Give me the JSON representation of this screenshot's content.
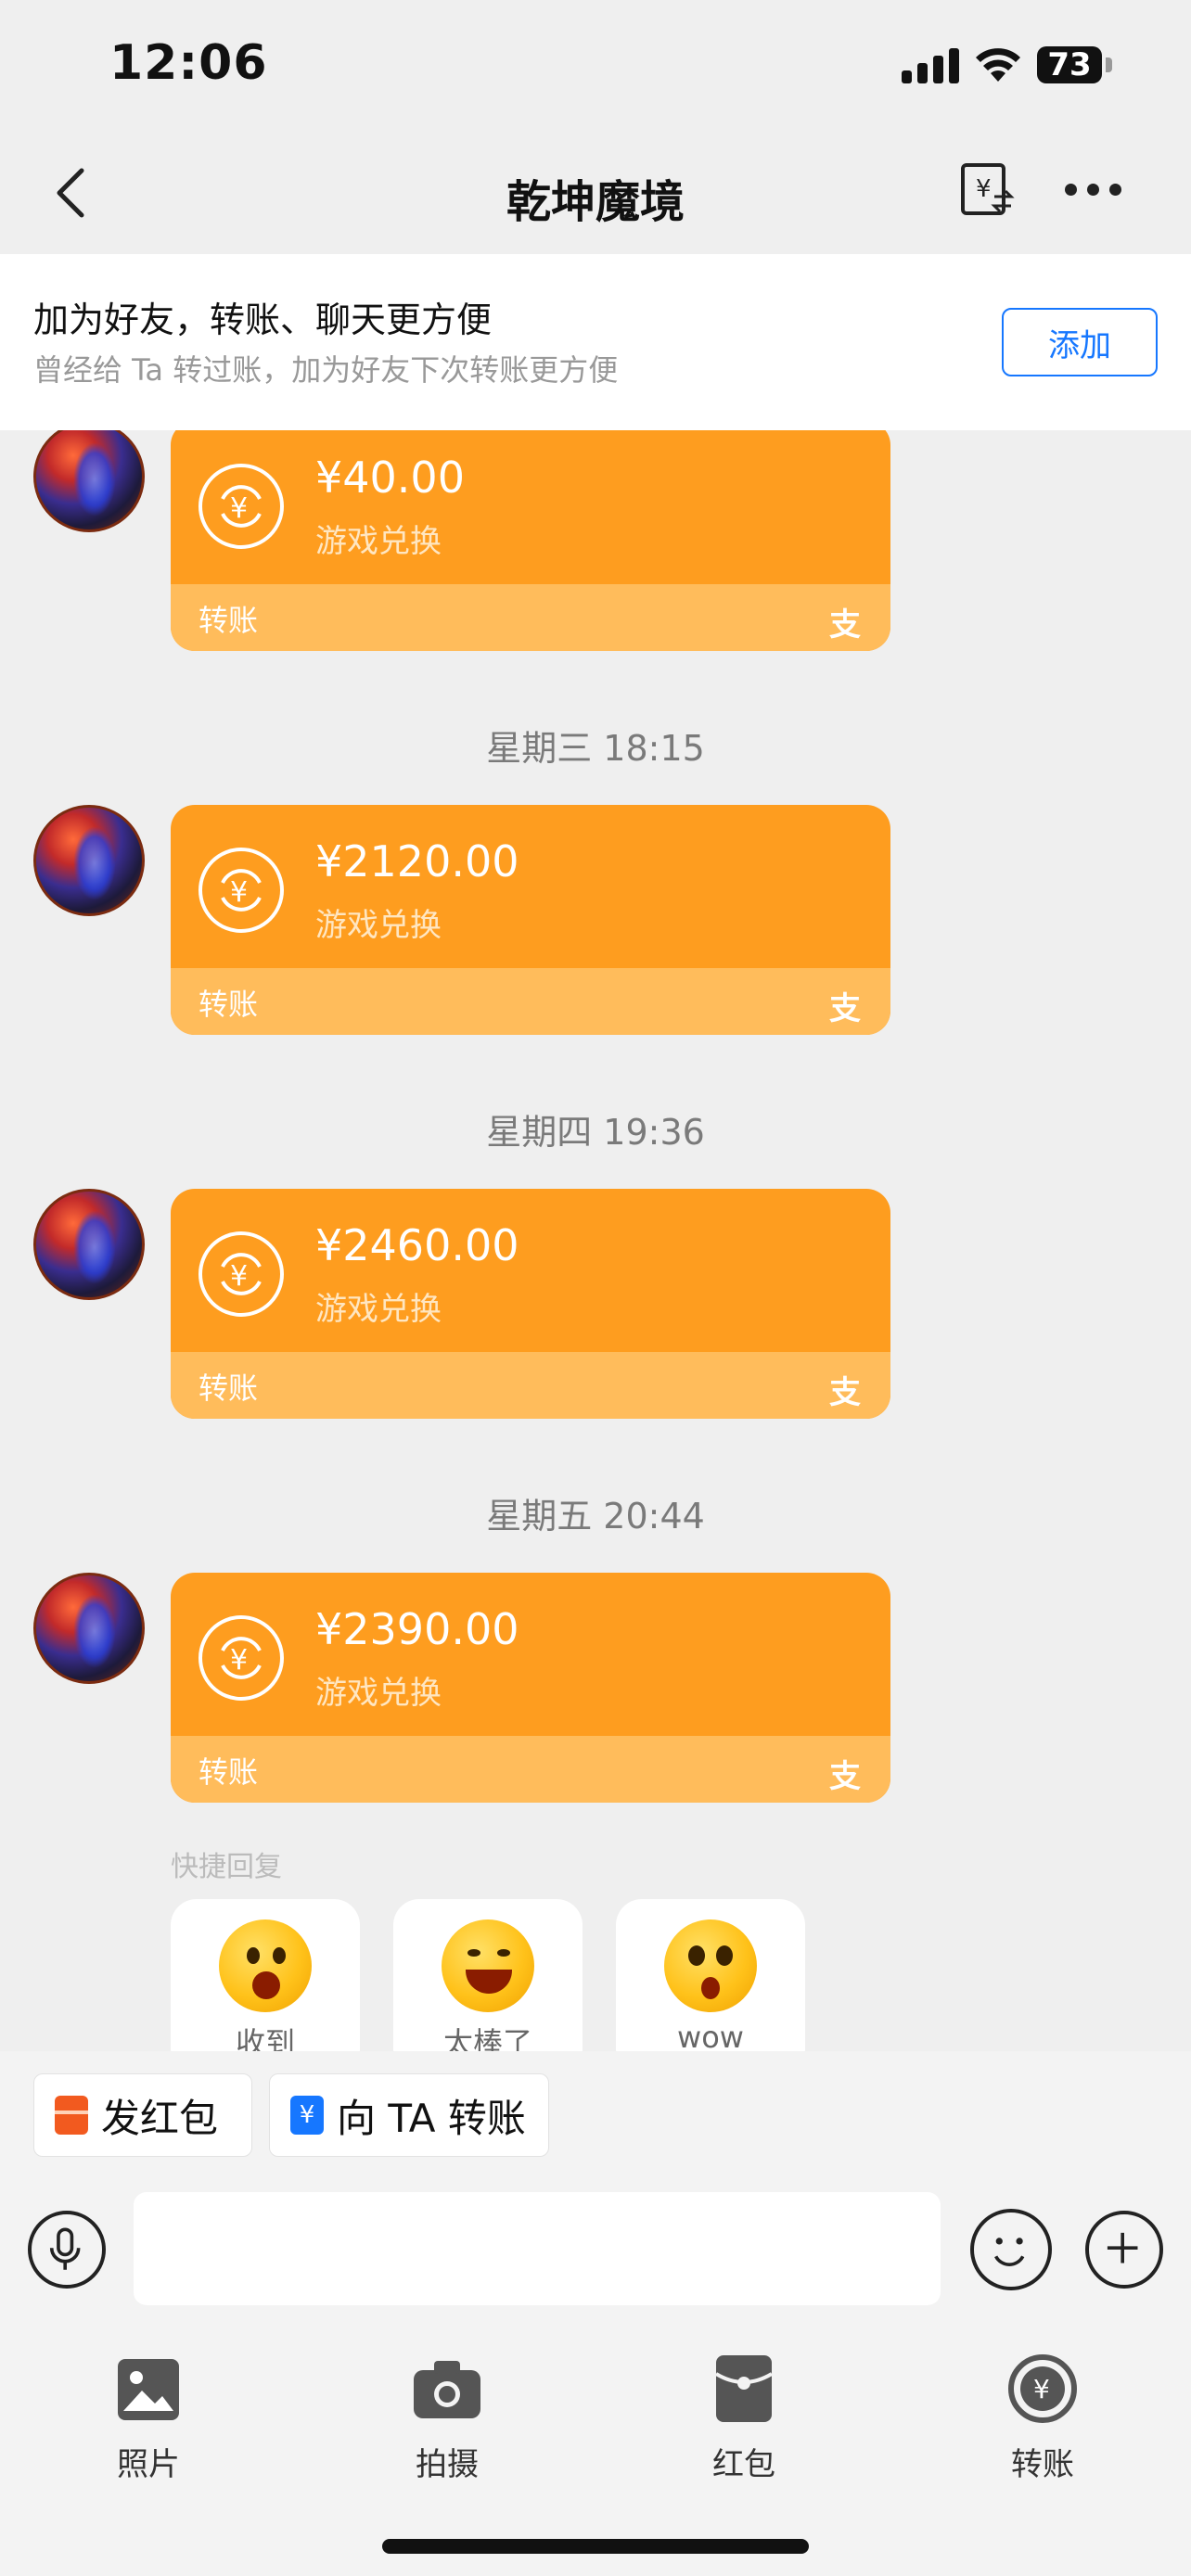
{
  "status_bar": {
    "time": "12:06",
    "battery": "73"
  },
  "nav": {
    "title": "乾坤魔境"
  },
  "banner": {
    "title": "加为好友，转账、聊天更方便",
    "subtitle": "曾经给 Ta 转过账，加为好友下次转账更方便",
    "add_label": "添加"
  },
  "messages": [
    {
      "amount": "¥40.00",
      "desc": "游戏兑换",
      "footer": "转账",
      "logo": "支"
    },
    {
      "amount": "¥2120.00",
      "desc": "游戏兑换",
      "footer": "转账",
      "logo": "支"
    },
    {
      "amount": "¥2460.00",
      "desc": "游戏兑换",
      "footer": "转账",
      "logo": "支"
    },
    {
      "amount": "¥2390.00",
      "desc": "游戏兑换",
      "footer": "转账",
      "logo": "支"
    }
  ],
  "timestamps": [
    "星期三 18:15",
    "星期四 19:36",
    "星期五 20:44"
  ],
  "quick_reply": {
    "label": "快捷回复",
    "items": [
      {
        "text": "收到",
        "icon": "ok-emoji-icon"
      },
      {
        "text": "太棒了",
        "icon": "laugh-cry-emoji-icon"
      },
      {
        "text": "wow",
        "icon": "wow-emoji-icon"
      }
    ]
  },
  "actions": {
    "red_packet": "发红包",
    "transfer": "向 TA 转账"
  },
  "tools": [
    {
      "label": "照片",
      "icon": "photo-icon"
    },
    {
      "label": "拍摄",
      "icon": "camera-icon"
    },
    {
      "label": "红包",
      "icon": "red-packet-icon"
    },
    {
      "label": "转账",
      "icon": "transfer-icon"
    }
  ],
  "colors": {
    "card": "#fe9d1f",
    "card_footer": "#ffbc5b",
    "accent": "#1677ff"
  }
}
